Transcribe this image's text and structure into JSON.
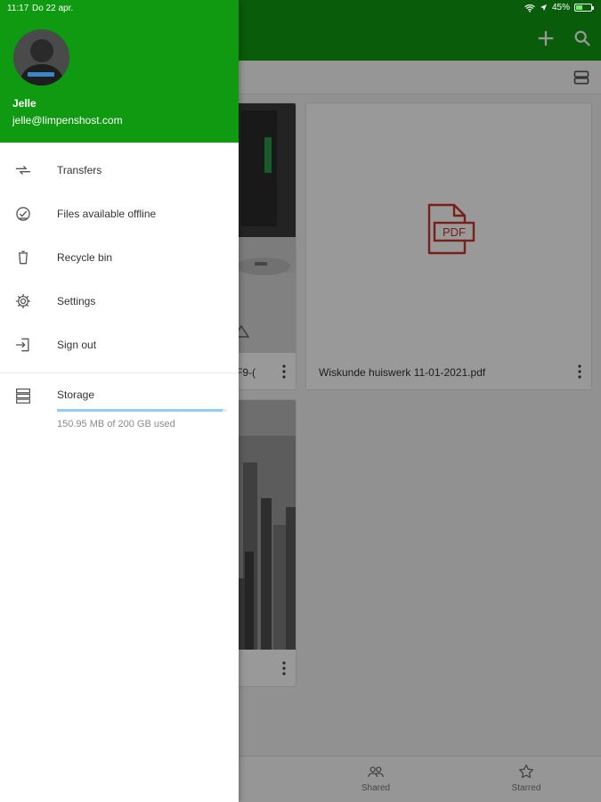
{
  "status_bar": {
    "time": "11:17",
    "date": "Do 22 apr.",
    "battery_text": "45%",
    "battery_level": 0.45
  },
  "drawer": {
    "user": {
      "name": "Jelle",
      "email": "jelle@limpenshost.com"
    },
    "menu": [
      {
        "label": "Transfers",
        "icon": "transfers-icon"
      },
      {
        "label": "Files available offline",
        "icon": "offline-check-icon"
      },
      {
        "label": "Recycle bin",
        "icon": "trash-icon"
      },
      {
        "label": "Settings",
        "icon": "gear-icon"
      },
      {
        "label": "Sign out",
        "icon": "sign-out-icon"
      }
    ],
    "storage": {
      "label": "Storage",
      "usage_text": "150.95 MB of 200 GB used",
      "used_fraction": 0.98
    }
  },
  "files": [
    {
      "name": "F9-(",
      "thumb": "photo-computer"
    },
    {
      "name": "Wiskunde huiswerk 11-01-2021.pdf",
      "thumb": "pdf-icon"
    },
    {
      "name": "",
      "thumb": "photo-city"
    }
  ],
  "bottom_nav": {
    "shared_label": "Shared",
    "starred_label": "Starred"
  },
  "colors": {
    "brand_green": "#0f9a12",
    "pdf_red": "#c9342a",
    "storage_bar": "#8fcff5"
  }
}
